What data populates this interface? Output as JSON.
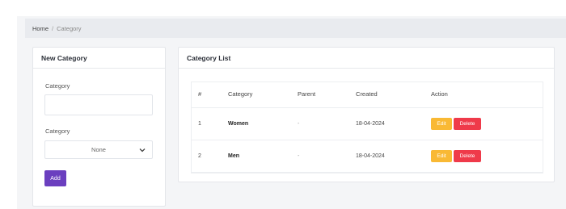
{
  "breadcrumb": {
    "home": "Home",
    "separator": "/",
    "current": "Category"
  },
  "new_category": {
    "title": "New Category",
    "name_label": "Category",
    "name_value": "",
    "parent_label": "Category",
    "parent_selected": "None",
    "add_label": "Add"
  },
  "category_list": {
    "title": "Category List",
    "columns": [
      "#",
      "Category",
      "Parent",
      "Created",
      "Action"
    ],
    "rows": [
      {
        "index": "1",
        "name": "Women",
        "parent": "-",
        "created": "18-04-2024",
        "edit": "Edit",
        "delete": "Delete"
      },
      {
        "index": "2",
        "name": "Men",
        "parent": "-",
        "created": "18-04-2024",
        "edit": "Edit",
        "delete": "Delete"
      }
    ]
  },
  "colors": {
    "add": "#6b3fbf",
    "edit": "#f9b934",
    "delete": "#ef3a4a"
  },
  "icons": {
    "select_caret": "chevron-down-icon"
  }
}
